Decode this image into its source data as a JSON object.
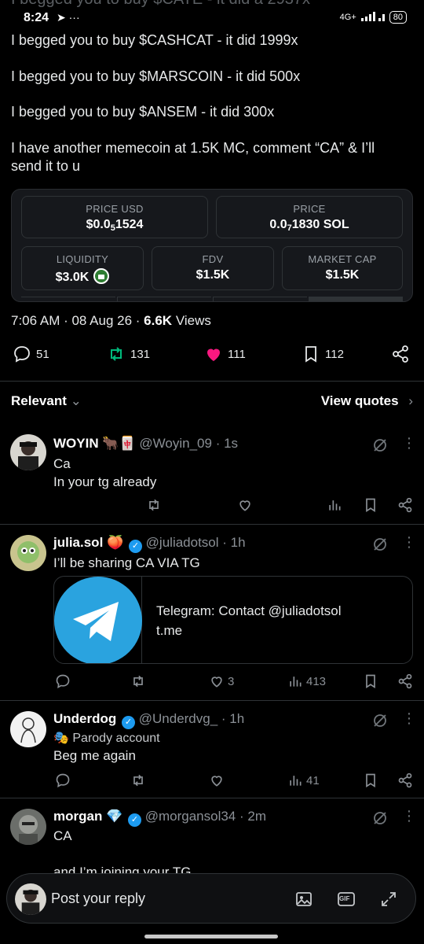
{
  "status_bar": {
    "ghost_text": "I begged you to buy $CATE - it did a 2937x",
    "time": "8:24",
    "left_icons": "➤ ···",
    "network": "4G+",
    "battery": "80"
  },
  "tweet": {
    "lines": [
      "I begged you to buy $CASHCAT - it did 1999x",
      "I begged you to buy $MARSCOIN - it did 500x",
      "I begged you to buy $ANSEM - it did 300x",
      "I have another memecoin at 1.5K MC, comment “CA” & I’ll",
      "send it to u"
    ],
    "card": {
      "price_usd_label": "PRICE USD",
      "price_usd_prefix": "$0.0",
      "price_usd_sub": "5",
      "price_usd_rest": "1524",
      "price_label": "PRICE",
      "price_prefix": "0.0",
      "price_sub": "7",
      "price_rest": "1830 SOL",
      "liquidity_label": "LIQUIDITY",
      "liquidity_value": "$3.0K",
      "fdv_label": "FDV",
      "fdv_value": "$1.5K",
      "mcap_label": "MARKET CAP",
      "mcap_value": "$1.5K"
    },
    "meta_time": "7:06 AM · 08 Aug 26 · ",
    "meta_views_count": "6.6K",
    "meta_views_label": " Views",
    "stats": {
      "replies": "51",
      "reposts": "131",
      "likes": "111",
      "bookmarks": "112"
    }
  },
  "sort": {
    "label": "Relevant",
    "quotes": "View quotes"
  },
  "replies": [
    {
      "name": "WOYIN",
      "emoji": "🐂🀄",
      "handle": "@Woyin_09 · 1s",
      "body1": "Ca",
      "body2": "In your tg already"
    },
    {
      "name": "julia.sol",
      "emoji": "🍑",
      "handle": "@juliadotsol · 1h",
      "body1": "I’ll be sharing CA VIA TG",
      "link_title": "Telegram: Contact @juliadotsol",
      "link_domain": "t.me",
      "likes": "3",
      "views": "413"
    },
    {
      "name": "Underdog",
      "handle": "@Underdvg_ · 1h",
      "parody": "Parody account",
      "body1": "Beg me again",
      "views": "41"
    },
    {
      "name": "morgan",
      "emoji": "💎",
      "handle": "@morgansol34 · 2m",
      "body1": "CA",
      "body2": "and I’m joining your TG"
    }
  ],
  "reply_bar": {
    "placeholder": "Post your reply",
    "gif": "GIF"
  },
  "colors": {
    "like": "#f91880",
    "repost": "#00ba7c",
    "verified": "#1d9bf0",
    "telegram": "#2aa3df"
  }
}
